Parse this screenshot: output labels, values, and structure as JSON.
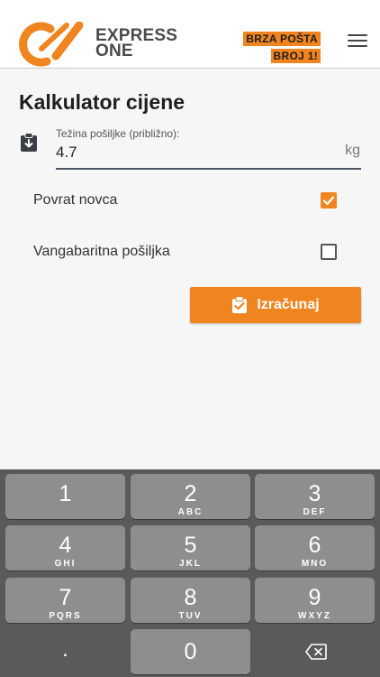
{
  "header": {
    "brand_line1": "EXPRESS",
    "brand_line2": "ONE",
    "slogan_line1": "BRZA POŠTA",
    "slogan_line2": "BROJ 1!",
    "menu_icon": "hamburger-icon"
  },
  "calculator": {
    "title": "Kalkulator cijene",
    "weight_label": "Težina pošiljke (približno):",
    "weight_value": "4.7",
    "weight_unit": "kg",
    "options": [
      {
        "label": "Povrat novca",
        "checked": true
      },
      {
        "label": "Vangabaritna pošiljka",
        "checked": false
      }
    ],
    "calculate_label": "Izračunaj"
  },
  "keyboard": {
    "keys": [
      {
        "num": "1",
        "letters": ""
      },
      {
        "num": "2",
        "letters": "ABC"
      },
      {
        "num": "3",
        "letters": "DEF"
      },
      {
        "num": "4",
        "letters": "GHI"
      },
      {
        "num": "5",
        "letters": "JKL"
      },
      {
        "num": "6",
        "letters": "MNO"
      },
      {
        "num": "7",
        "letters": "PQRS"
      },
      {
        "num": "8",
        "letters": "TUV"
      },
      {
        "num": "9",
        "letters": "WXYZ"
      },
      {
        "num": ".",
        "letters": ""
      },
      {
        "num": "0",
        "letters": ""
      }
    ],
    "backspace_icon": "backspace-icon"
  },
  "colors": {
    "accent": "#f0841f",
    "keyboard_bg": "#5a5a5d",
    "key_bg": "#8e8e91"
  }
}
